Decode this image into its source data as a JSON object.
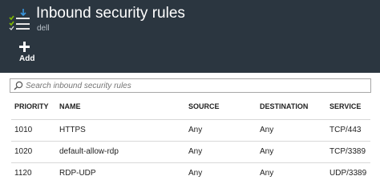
{
  "header": {
    "title": "Inbound security rules",
    "subtitle": "dell",
    "add_label": "Add"
  },
  "search": {
    "placeholder": "Search inbound security rules"
  },
  "table": {
    "columns": [
      "PRIORITY",
      "NAME",
      "SOURCE",
      "DESTINATION",
      "SERVICE"
    ],
    "rows": [
      [
        "1010",
        "HTTPS",
        "Any",
        "Any",
        "TCP/443"
      ],
      [
        "1020",
        "default-allow-rdp",
        "Any",
        "Any",
        "TCP/3389"
      ],
      [
        "1120",
        "RDP-UDP",
        "Any",
        "Any",
        "UDP/3389"
      ]
    ]
  },
  "colors": {
    "header_bg": "#2b3640",
    "accent_blue": "#3a96dd",
    "accent_green": "#7fba00"
  }
}
